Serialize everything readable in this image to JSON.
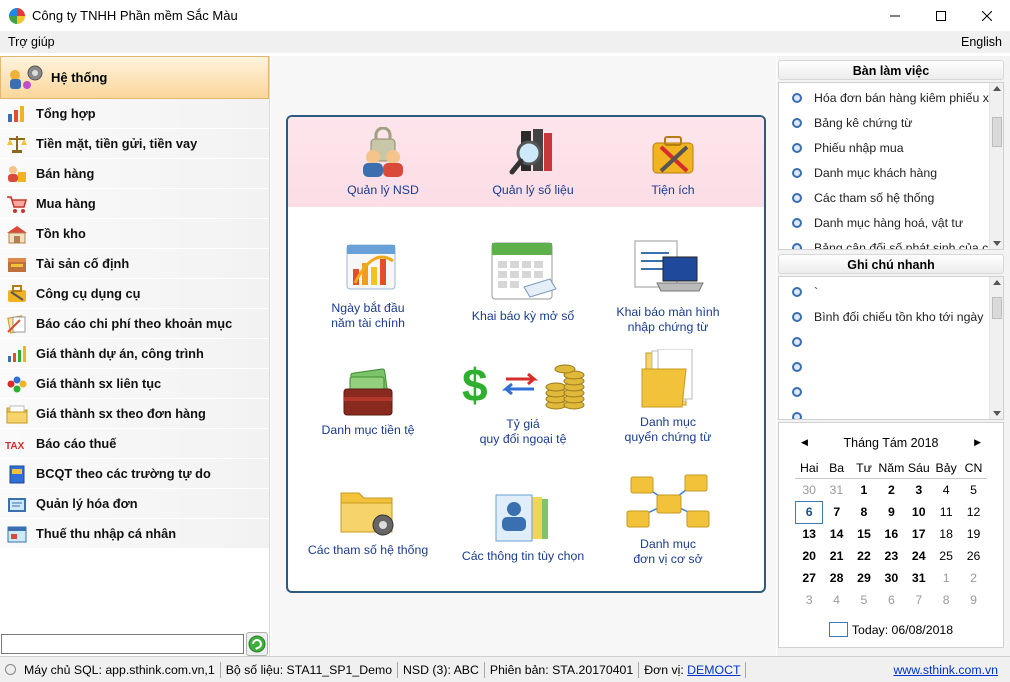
{
  "window": {
    "title": "Công ty TNHH Phần mềm Sắc Màu"
  },
  "menubar": {
    "help": "Trợ giúp",
    "language": "English"
  },
  "sidebar": {
    "active": {
      "label": "Hệ thống",
      "icon": "system-icon"
    },
    "items": [
      {
        "label": "Tổng hợp",
        "icon": "summary-icon"
      },
      {
        "label": "Tiền mặt, tiền gửi, tiền vay",
        "icon": "scale-icon"
      },
      {
        "label": "Bán hàng",
        "icon": "sales-icon"
      },
      {
        "label": "Mua hàng",
        "icon": "cart-icon"
      },
      {
        "label": "Tồn kho",
        "icon": "warehouse-icon"
      },
      {
        "label": "Tài sản cố định",
        "icon": "asset-icon"
      },
      {
        "label": "Công cụ dụng cụ",
        "icon": "tools-icon"
      },
      {
        "label": "Báo cáo chi phí theo khoản mục",
        "icon": "cost-report-icon"
      },
      {
        "label": "Giá thành dự án, công trình",
        "icon": "bar-chart-icon"
      },
      {
        "label": "Giá thành sx liên tục",
        "icon": "molecule-icon"
      },
      {
        "label": "Giá thành sx theo đơn hàng",
        "icon": "folder-icon"
      },
      {
        "label": "Báo cáo thuế",
        "icon": "tax-icon"
      },
      {
        "label": "BCQT theo các trường tự do",
        "icon": "book-icon"
      },
      {
        "label": "Quản lý hóa đơn",
        "icon": "invoice-icon"
      },
      {
        "label": "Thuế thu nhập cá nhân",
        "icon": "personal-tax-icon"
      }
    ],
    "search_value": ""
  },
  "main": {
    "top_tiles": [
      {
        "label": "Quản lý NSD",
        "icon": "users-lock-icon"
      },
      {
        "label": "Quản lý số liệu",
        "icon": "data-search-icon"
      },
      {
        "label": "Tiện ích",
        "icon": "utility-toolbox-icon"
      }
    ],
    "tiles": [
      {
        "line1": "Ngày bắt đầu",
        "line2": "năm tài chính",
        "icon": "calendar-chart-icon"
      },
      {
        "line1": "Khai báo kỳ mở sổ",
        "line2": "",
        "icon": "calendar-grid-icon"
      },
      {
        "line1": "Khai báo màn hình",
        "line2": "nhập chứng từ",
        "icon": "laptop-form-icon"
      },
      {
        "line1": "Danh mục tiền tệ",
        "line2": "",
        "icon": "money-wallet-icon"
      },
      {
        "line1": "Tỷ giá",
        "line2": "quy đổi ngoại tệ",
        "icon": "exchange-rate-icon"
      },
      {
        "line1": "Danh mục",
        "line2": "quyển chứng từ",
        "icon": "document-folder-icon"
      },
      {
        "line1": "Các tham số hệ thống",
        "line2": "",
        "icon": "folder-gear-icon"
      },
      {
        "line1": "Các thông tin tùy chọn",
        "line2": "",
        "icon": "user-profile-icon"
      },
      {
        "line1": "Danh mục",
        "line2": "đơn vị cơ sở",
        "icon": "org-network-icon"
      }
    ]
  },
  "workspace": {
    "title": "Bàn làm việc",
    "items": [
      "Hóa đơn bán hàng kiêm phiếu x",
      "Bảng kê chứng từ",
      "Phiếu nhập mua",
      "Danh mục khách hàng",
      "Các tham số hệ thống",
      "Danh mục hàng hoá, vật tư",
      "Bảng cân đối số phát sinh của c"
    ]
  },
  "quicknotes": {
    "title": "Ghi chú nhanh",
    "items": [
      "`",
      "Bình đối chiếu tồn kho tới ngày",
      "",
      "",
      "",
      ""
    ]
  },
  "calendar": {
    "month_label": "Tháng Tám 2018",
    "weekdays": [
      "Hai",
      "Ba",
      "Tư",
      "Năm",
      "Sáu",
      "Bảy",
      "CN"
    ],
    "weeks": [
      [
        {
          "d": "30",
          "dim": true
        },
        {
          "d": "31",
          "dim": true
        },
        {
          "d": "1"
        },
        {
          "d": "2"
        },
        {
          "d": "3"
        },
        {
          "d": "4",
          "light": true
        },
        {
          "d": "5",
          "light": true
        }
      ],
      [
        {
          "d": "6",
          "today": true
        },
        {
          "d": "7"
        },
        {
          "d": "8"
        },
        {
          "d": "9"
        },
        {
          "d": "10"
        },
        {
          "d": "11",
          "light": true
        },
        {
          "d": "12",
          "light": true
        }
      ],
      [
        {
          "d": "13"
        },
        {
          "d": "14"
        },
        {
          "d": "15"
        },
        {
          "d": "16"
        },
        {
          "d": "17"
        },
        {
          "d": "18",
          "light": true
        },
        {
          "d": "19",
          "light": true
        }
      ],
      [
        {
          "d": "20"
        },
        {
          "d": "21"
        },
        {
          "d": "22"
        },
        {
          "d": "23"
        },
        {
          "d": "24"
        },
        {
          "d": "25",
          "light": true
        },
        {
          "d": "26",
          "light": true
        }
      ],
      [
        {
          "d": "27"
        },
        {
          "d": "28"
        },
        {
          "d": "29"
        },
        {
          "d": "30"
        },
        {
          "d": "31"
        },
        {
          "d": "1",
          "dim": true
        },
        {
          "d": "2",
          "dim": true
        }
      ],
      [
        {
          "d": "3",
          "dim": true
        },
        {
          "d": "4",
          "dim": true
        },
        {
          "d": "5",
          "dim": true
        },
        {
          "d": "6",
          "dim": true
        },
        {
          "d": "7",
          "dim": true
        },
        {
          "d": "8",
          "dim": true
        },
        {
          "d": "9",
          "dim": true
        }
      ]
    ],
    "today_label": "Today: 06/08/2018"
  },
  "statusbar": {
    "server": "Máy chủ SQL: app.sthink.com.vn,1",
    "dataset": "Bộ số liệu: STA11_SP1_Demo",
    "user": "NSD (3): ABC",
    "version": "Phiên bản: STA.20170401",
    "unit_label": "Đơn vị:",
    "unit_link": "DEMOCT",
    "website": "www.sthink.com.vn"
  },
  "colors": {
    "accent_blue": "#1a3b8f",
    "card_border": "#2d5a7e",
    "active_nav": "#fbd69a"
  }
}
